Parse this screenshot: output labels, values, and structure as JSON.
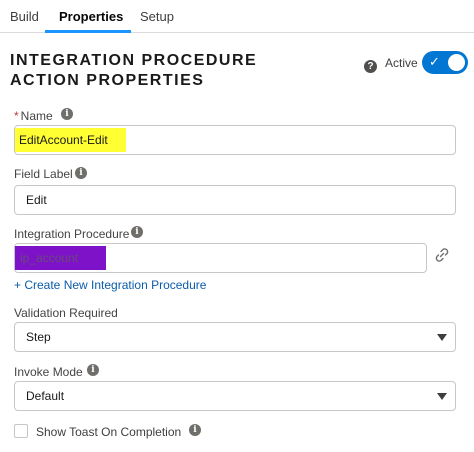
{
  "tabs": [
    {
      "label": "Build"
    },
    {
      "label": "Properties",
      "active": true
    },
    {
      "label": "Setup"
    }
  ],
  "heading": {
    "line1": "INTEGRATION PROCEDURE",
    "line2": "ACTION PROPERTIES"
  },
  "active_toggle": {
    "label": "Active",
    "state": "on",
    "help_icon": "question-icon",
    "check_icon": "check-icon"
  },
  "fields": {
    "name": {
      "required_mark": "*",
      "label": "Name",
      "value": "EditAccount-Edit",
      "icon": "info-icon"
    },
    "field_label": {
      "label": "Field Label",
      "value": "Edit",
      "icon": "info-icon"
    },
    "integration_procedure": {
      "label": "Integration Procedure",
      "value": "ip_account",
      "icon": "info-icon",
      "link_icon": "link-icon"
    },
    "create_link": "+ Create New Integration Procedure",
    "validation_required": {
      "label": "Validation Required",
      "value": "Step"
    },
    "invoke_mode": {
      "label": "Invoke Mode",
      "value": "Default",
      "icon": "info-icon"
    },
    "show_toast": {
      "label": "Show Toast On Completion",
      "checked": false,
      "icon": "info-icon"
    }
  },
  "colors": {
    "accent": "#0176d3",
    "highlight_yellow": "#ffff33",
    "highlight_purple": "#7d12c8",
    "link": "#0b5cab",
    "required": "#c23934"
  }
}
